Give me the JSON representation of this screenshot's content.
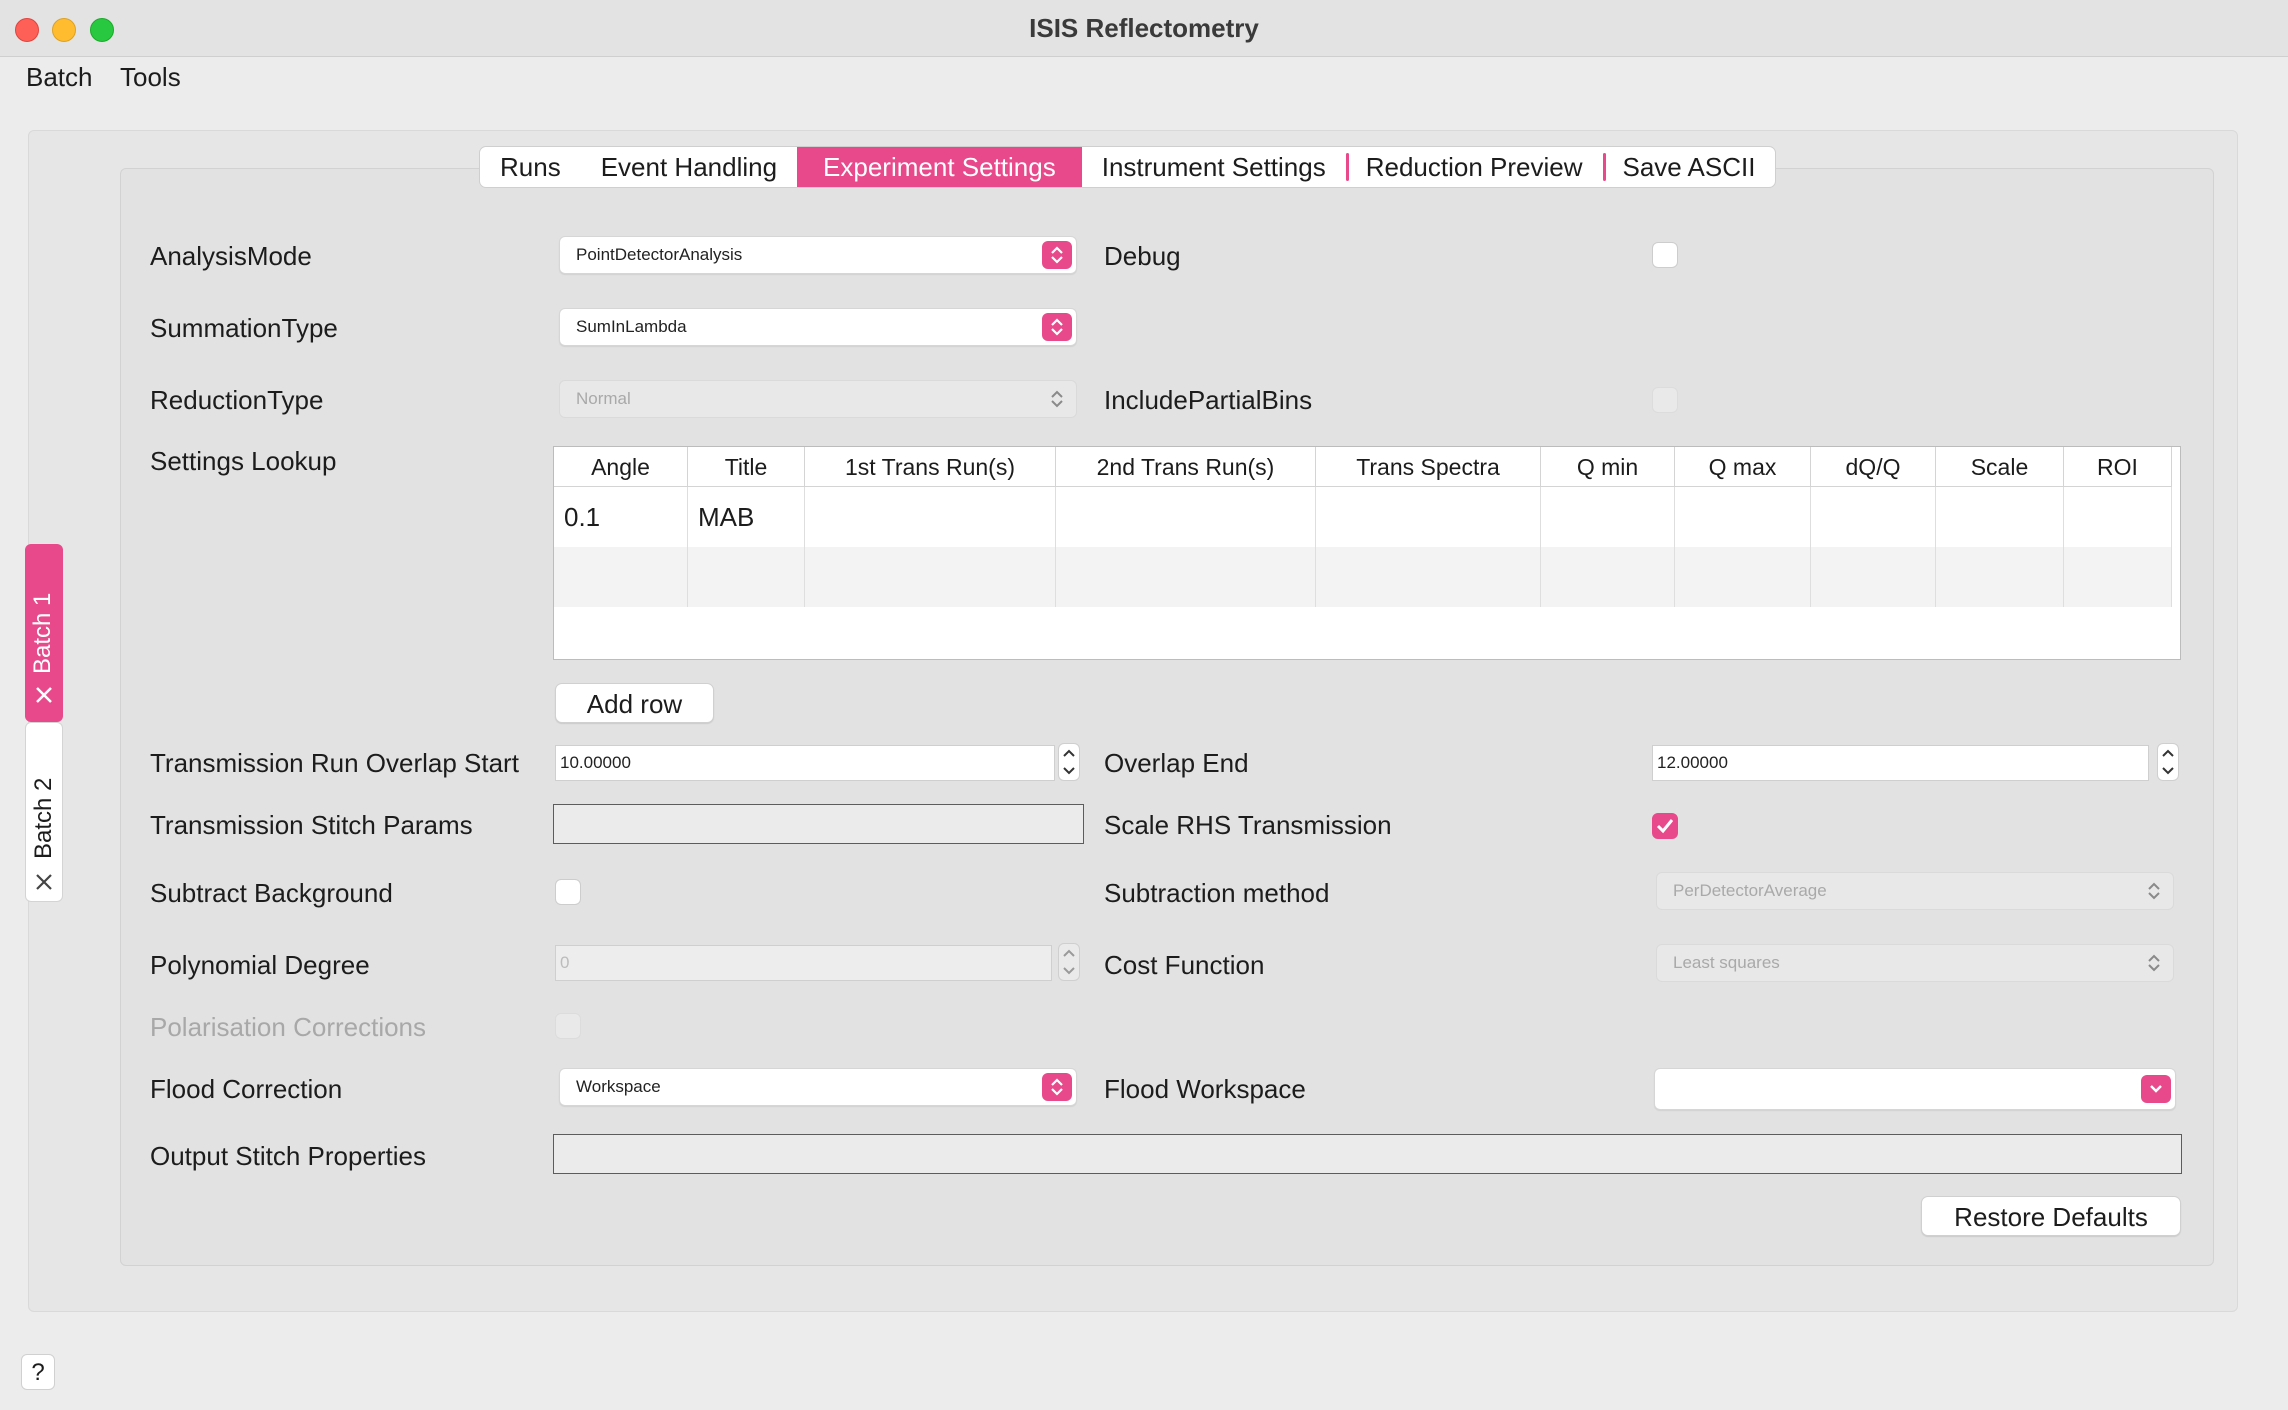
{
  "window": {
    "title": "ISIS Reflectometry"
  },
  "menubar": {
    "items": [
      "Batch",
      "Tools"
    ]
  },
  "batch_tabs": [
    {
      "label": "Batch 1",
      "active": true
    },
    {
      "label": "Batch 2",
      "active": false
    }
  ],
  "tabs": [
    {
      "label": "Runs"
    },
    {
      "label": "Event Handling"
    },
    {
      "label": "Experiment Settings",
      "active": true
    },
    {
      "label": "Instrument Settings"
    },
    {
      "label": "Reduction Preview"
    },
    {
      "label": "Save ASCII"
    }
  ],
  "form": {
    "analysis_mode": {
      "label": "AnalysisMode",
      "value": "PointDetectorAnalysis"
    },
    "debug": {
      "label": "Debug",
      "checked": false
    },
    "summation_type": {
      "label": "SummationType",
      "value": "SumInLambda"
    },
    "reduction_type": {
      "label": "ReductionType",
      "value": "Normal",
      "enabled": false
    },
    "include_partial_bins": {
      "label": "IncludePartialBins",
      "checked": false,
      "enabled": false
    },
    "settings_lookup": {
      "label": "Settings Lookup"
    },
    "add_row": {
      "label": "Add row"
    },
    "transmission_overlap_start": {
      "label": "Transmission Run Overlap Start",
      "value": "10.00000"
    },
    "overlap_end": {
      "label": "Overlap End",
      "value": "12.00000"
    },
    "transmission_stitch_params": {
      "label": "Transmission Stitch Params",
      "value": ""
    },
    "scale_rhs_transmission": {
      "label": "Scale RHS Transmission",
      "checked": true
    },
    "subtract_background": {
      "label": "Subtract Background",
      "checked": false
    },
    "subtraction_method": {
      "label": "Subtraction method",
      "value": "PerDetectorAverage",
      "enabled": false
    },
    "polynomial_degree": {
      "label": "Polynomial Degree",
      "value": "0",
      "enabled": false
    },
    "cost_function": {
      "label": "Cost Function",
      "value": "Least squares",
      "enabled": false
    },
    "polarisation_corrections": {
      "label": "Polarisation Corrections",
      "checked": false,
      "enabled": false
    },
    "flood_correction": {
      "label": "Flood Correction",
      "value": "Workspace"
    },
    "flood_workspace": {
      "label": "Flood Workspace",
      "value": ""
    },
    "output_stitch_properties": {
      "label": "Output Stitch Properties",
      "value": ""
    },
    "restore_defaults": {
      "label": "Restore Defaults"
    }
  },
  "lookup_table": {
    "columns": [
      "Angle",
      "Title",
      "1st Trans Run(s)",
      "2nd Trans Run(s)",
      "Trans Spectra",
      "Q min",
      "Q max",
      "dQ/Q",
      "Scale",
      "ROI"
    ],
    "rows": [
      [
        "0.1",
        "MAB",
        "",
        "",
        "",
        "",
        "",
        "",
        "",
        ""
      ],
      [
        "",
        "",
        "",
        "",
        "",
        "",
        "",
        "",
        "",
        ""
      ]
    ]
  },
  "help": {
    "label": "?"
  },
  "colors": {
    "accent": "#e8498a"
  }
}
